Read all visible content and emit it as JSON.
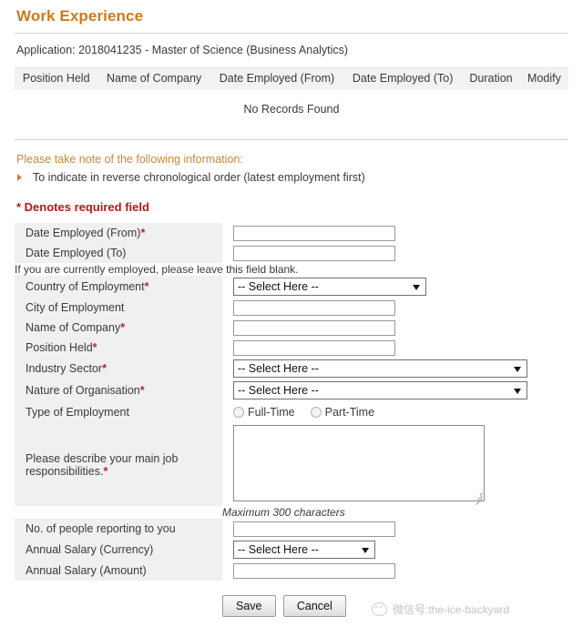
{
  "header": {
    "title": "Work Experience",
    "application_line": "Application: 2018041235 - Master of Science (Business Analytics)"
  },
  "records_table": {
    "columns": [
      "Position Held",
      "Name of Company",
      "Date Employed (From)",
      "Date Employed (To)",
      "Duration",
      "Modify"
    ],
    "empty_message": "No Records Found"
  },
  "notice": {
    "title": "Please take note of the following information:",
    "items": [
      "To indicate in reverse chronological order (latest employment first)"
    ],
    "required_field_note": "* Denotes required field"
  },
  "form": {
    "select_placeholder": "-- Select Here --",
    "fields": {
      "date_from": {
        "label": "Date Employed (From)",
        "required": "*",
        "value": ""
      },
      "date_to": {
        "label": "Date Employed (To)",
        "required": "",
        "value": ""
      },
      "date_to_hint": "If you are currently employed, please leave this field blank.",
      "country": {
        "label": "Country of Employment",
        "required": "*",
        "value": "-- Select Here --"
      },
      "city": {
        "label": "City of Employment",
        "required": "",
        "value": ""
      },
      "company": {
        "label": "Name of Company",
        "required": "*",
        "value": ""
      },
      "position": {
        "label": "Position Held",
        "required": "*",
        "value": ""
      },
      "industry": {
        "label": "Industry Sector",
        "required": "*",
        "value": "-- Select Here --"
      },
      "nature": {
        "label": "Nature of Organisation",
        "required": "*",
        "value": "-- Select Here --"
      },
      "employment_type": {
        "label": "Type of Employment",
        "options": [
          "Full-Time",
          "Part-Time"
        ],
        "selected": ""
      },
      "responsibilities": {
        "label": "Please describe your main job responsibilities.",
        "required": "*",
        "value": "",
        "hint": "Maximum 300 characters"
      },
      "reports": {
        "label": "No. of people reporting to you",
        "required": "",
        "value": ""
      },
      "salary_currency": {
        "label": "Annual Salary (Currency)",
        "required": "",
        "value": "-- Select Here --"
      },
      "salary_amount": {
        "label": "Annual Salary (Amount)",
        "required": "",
        "value": ""
      }
    }
  },
  "buttons": {
    "save": "Save",
    "cancel": "Cancel"
  },
  "watermark": {
    "text": "微信号:the-ice-backyard"
  },
  "colors": {
    "title": "#cc7a1f",
    "required_red": "#b01a1a",
    "asterisk": "#b5224a",
    "notice_title": "#c8883c",
    "label_bg": "#f0f0f0",
    "table_header_bg": "#f2f2f2"
  }
}
